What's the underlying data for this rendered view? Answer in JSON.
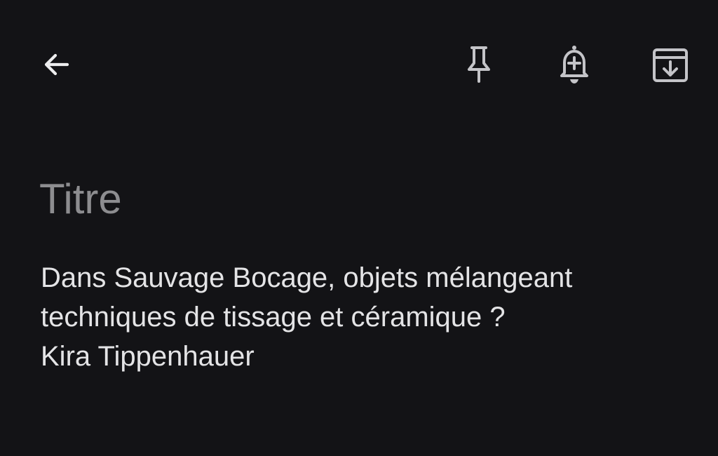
{
  "toolbar": {
    "back_icon": "arrow-back-icon",
    "pin_icon": "pin-icon",
    "reminder_icon": "add-alert-icon",
    "archive_icon": "archive-icon"
  },
  "note": {
    "title_placeholder": "Titre",
    "body_lines": [
      "Dans Sauvage Bocage, objets mélangeant",
      "techniques de tissage et céramique ?",
      "Kira Tippenhauer"
    ]
  },
  "colors": {
    "background": "#131316",
    "icon": "#c4c4c8",
    "placeholder": "#8d8d90",
    "text": "#e4e4e6"
  }
}
